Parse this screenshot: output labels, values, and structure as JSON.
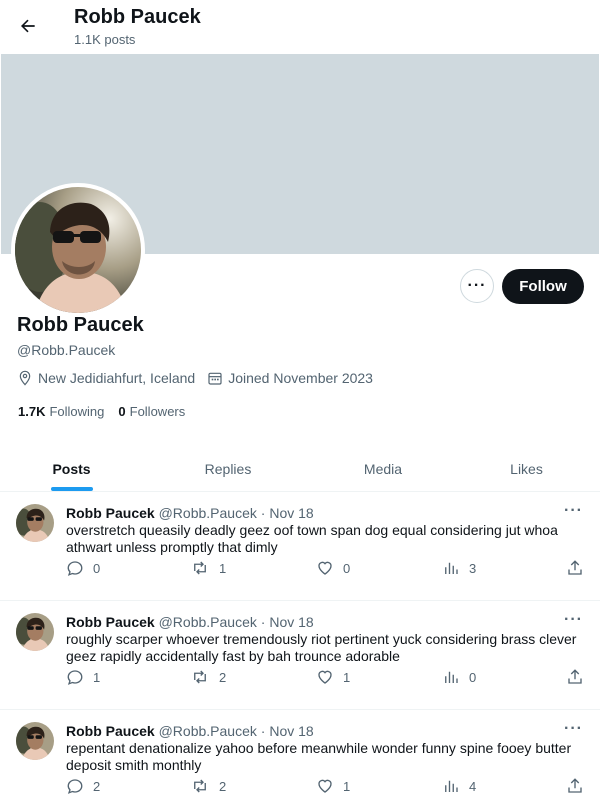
{
  "header": {
    "title": "Robb Paucek",
    "posts_count": "1.1K posts"
  },
  "profile": {
    "name": "Robb Paucek",
    "handle": "@Robb.Paucek",
    "location": "New Jedidiahfurt, Iceland",
    "joined": "Joined November 2023",
    "following_count": "1.7K",
    "following_label": "Following",
    "followers_count": "0",
    "followers_label": "Followers",
    "follow_label": "Follow",
    "more_label": "···",
    "banner_color": "#cfd9de"
  },
  "tabs": [
    {
      "label": "Posts"
    },
    {
      "label": "Replies"
    },
    {
      "label": "Media"
    },
    {
      "label": "Likes"
    }
  ],
  "posts": [
    {
      "name": "Robb Paucek",
      "handle": "@Robb.Paucek",
      "sep": "·",
      "date": "Nov 18",
      "text": "overstretch queasily deadly geez oof town span dog equal considering jut whoa athwart unless promptly that dimly",
      "replies": "0",
      "reposts": "1",
      "likes": "0",
      "views": "3"
    },
    {
      "name": "Robb Paucek",
      "handle": "@Robb.Paucek",
      "sep": "·",
      "date": "Nov 18",
      "text": "roughly scarper whoever tremendously riot pertinent yuck considering brass clever geez rapidly accidentally fast by bah trounce adorable",
      "replies": "1",
      "reposts": "2",
      "likes": "1",
      "views": "0"
    },
    {
      "name": "Robb Paucek",
      "handle": "@Robb.Paucek",
      "sep": "·",
      "date": "Nov 18",
      "text": "repentant denationalize yahoo before meanwhile wonder funny spine fooey butter deposit smith monthly",
      "replies": "2",
      "reposts": "2",
      "likes": "1",
      "views": "4"
    }
  ],
  "colors": {
    "accent": "#1d9bf0",
    "text": "#0f1419",
    "muted": "#536471",
    "button_dark": "#0f1419"
  },
  "icons": [
    "back-arrow-icon",
    "location-icon",
    "calendar-icon",
    "reply-icon",
    "repost-icon",
    "like-icon",
    "views-icon",
    "share-icon",
    "more-icon"
  ]
}
